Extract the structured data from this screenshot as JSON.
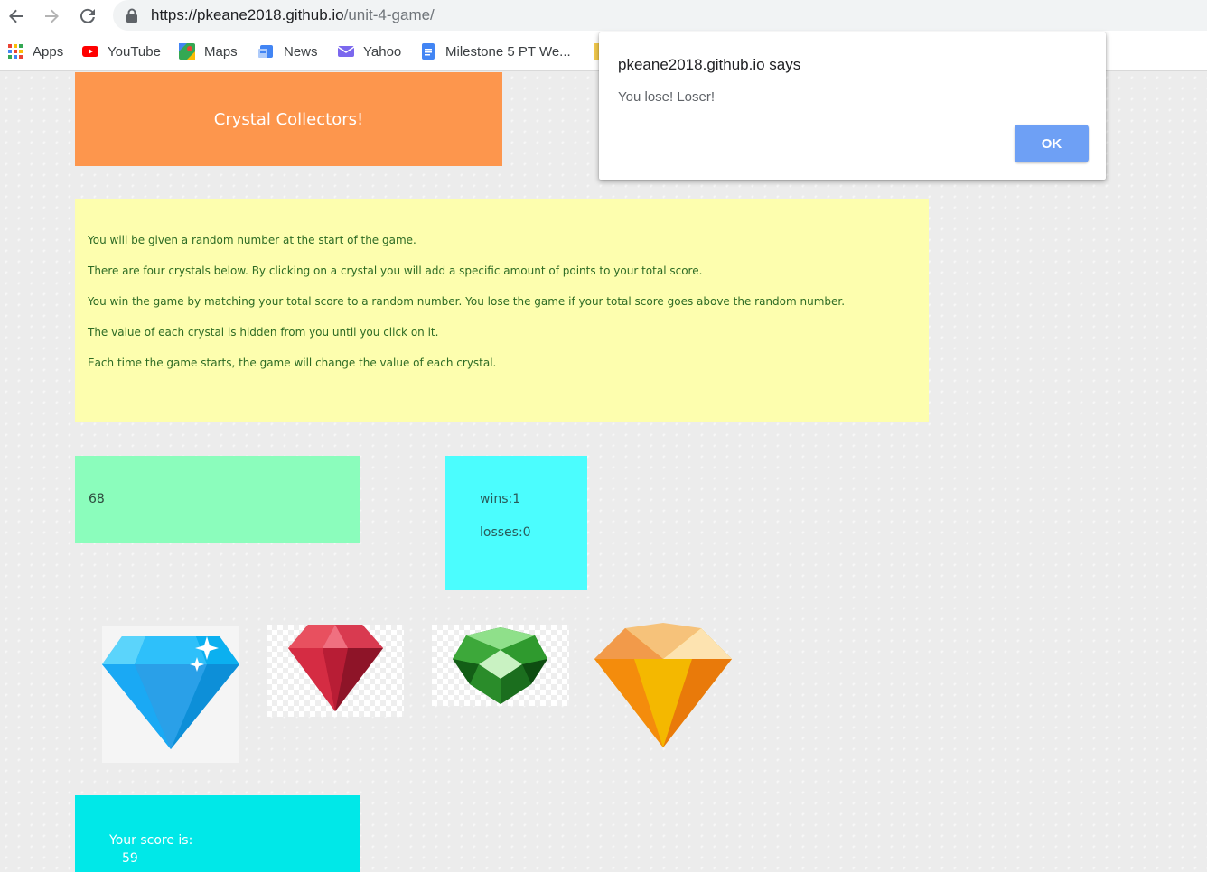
{
  "browser": {
    "url_host": "https://pkeane2018.github.io",
    "url_path": "/unit-4-game/",
    "bookmarks": [
      {
        "label": "Apps",
        "icon": "apps-grid-icon"
      },
      {
        "label": "YouTube",
        "icon": "youtube-icon"
      },
      {
        "label": "Maps",
        "icon": "maps-icon"
      },
      {
        "label": "News",
        "icon": "news-icon"
      },
      {
        "label": "Yahoo",
        "icon": "yahoo-mail-icon"
      },
      {
        "label": "Milestone 5 PT We...",
        "icon": "google-docs-icon"
      }
    ]
  },
  "game": {
    "title": "Crystal Collectors!",
    "instructions": [
      "You will be given a random number at the start of the game.",
      "There are four crystals below. By clicking on a crystal you will add a specific amount of points to your total score.",
      "You win the game by matching your total score to a random number. You lose the game if your total score goes above the random number.",
      "The value of each crystal is hidden from you until you click on it.",
      "Each time the game starts, the game will change the value of each crystal."
    ],
    "target_number": "68",
    "wins_label": "wins:1",
    "losses_label": "losses:0",
    "score_label": "Your score is:",
    "score_value": "59",
    "crystals": [
      "blue-diamond-crystal",
      "red-ruby-crystal",
      "green-emerald-crystal",
      "orange-gem-crystal"
    ]
  },
  "dialog": {
    "title": "pkeane2018.github.io says",
    "message": "You lose! Loser!",
    "ok_label": "OK"
  },
  "colors": {
    "title_bg": "#fd964d",
    "instructions_bg": "#fdfeae",
    "target_bg": "#8bfdbc",
    "stats_bg": "#4bfdfe",
    "score_bg": "#00e8e8",
    "ok_button": "#6ea0f5"
  }
}
